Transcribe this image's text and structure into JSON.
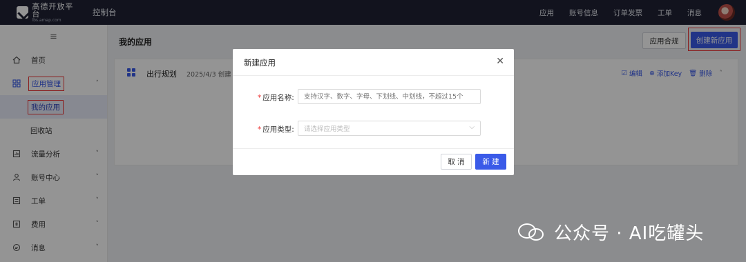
{
  "topbar": {
    "logo_name": "高德开放平台",
    "logo_sub": "lbs.amap.com",
    "console": "控制台",
    "nav": [
      "应用",
      "账号信息",
      "订单发票",
      "工单",
      "消息"
    ]
  },
  "sidebar": {
    "collapse_icon": "≡",
    "items": [
      {
        "label": "首页",
        "icon": "home-icon"
      },
      {
        "label": "应用管理",
        "icon": "grid-icon",
        "caret": "˄"
      },
      {
        "label": "我的应用",
        "sub": true
      },
      {
        "label": "回收站",
        "sub": true
      },
      {
        "label": "流量分析",
        "icon": "chart-icon",
        "caret": "˅"
      },
      {
        "label": "账号中心",
        "icon": "user-icon",
        "caret": "˅"
      },
      {
        "label": "工单",
        "icon": "ticket-icon",
        "caret": "˅"
      },
      {
        "label": "费用",
        "icon": "fee-icon",
        "caret": "˅"
      },
      {
        "label": "消息",
        "icon": "message-icon",
        "caret": "˅"
      }
    ]
  },
  "main": {
    "title": "我的应用",
    "compliance_button": "应用合规",
    "create_button": "创建新应用",
    "app_card": {
      "name": "出行规划",
      "date": "2025/4/3 创建",
      "actions": [
        "编辑",
        "添加Key",
        "删除"
      ]
    }
  },
  "dialog": {
    "title": "新建应用",
    "close": "✕",
    "name_label": "应用名称:",
    "name_placeholder": "支持汉字、数字、字母、下划线、中划线，不超过15个",
    "type_label": "应用类型:",
    "type_placeholder": "请选择应用类型",
    "required_mark": "*",
    "cancel": "取 消",
    "submit": "新 建"
  },
  "watermark": {
    "text": "公众号 · AI吃罐头"
  },
  "colors": {
    "topbar": "#1f2235",
    "accent": "#3a5ae8",
    "highlight_box": "#e33333"
  }
}
